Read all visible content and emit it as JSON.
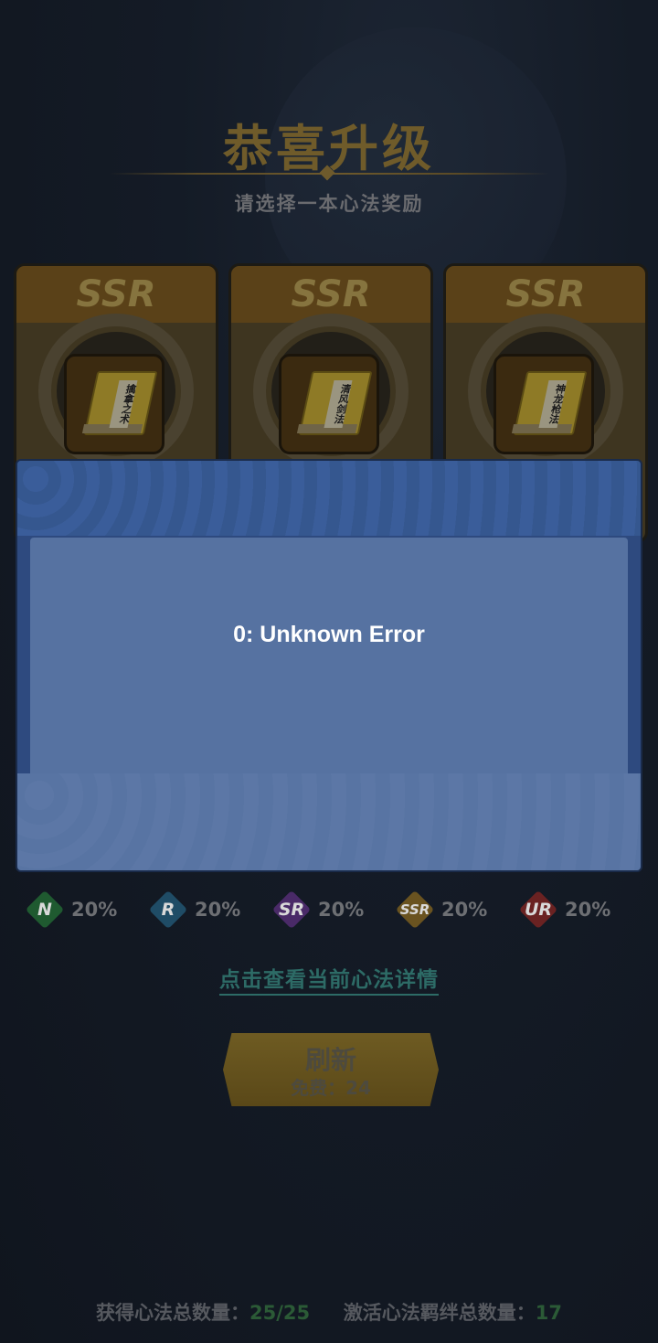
{
  "header": {
    "title": "恭喜升级",
    "subtitle": "请选择一本心法奖励"
  },
  "cards": [
    {
      "rarity": "SSR",
      "book_title": "擒拿之术"
    },
    {
      "rarity": "SSR",
      "book_title": "清风剑法"
    },
    {
      "rarity": "SSR",
      "book_title": "神龙枪法"
    }
  ],
  "dialog": {
    "message": "0: Unknown Error"
  },
  "rates": [
    {
      "tier": "N",
      "value": "20%",
      "color": "#1f5a30"
    },
    {
      "tier": "R",
      "value": "20%",
      "color": "#1f4c66"
    },
    {
      "tier": "SR",
      "value": "20%",
      "color": "#4a2a68"
    },
    {
      "tier": "SSR",
      "value": "20%",
      "color": "#6a5320"
    },
    {
      "tier": "UR",
      "value": "20%",
      "color": "#6a2222"
    }
  ],
  "detail_link": "点击查看当前心法详情",
  "refresh": {
    "label": "刷新",
    "cost_label": "免费：24"
  },
  "stats": {
    "obtained_label": "获得心法总数量：",
    "obtained_value": "25/25",
    "bond_label": "激活心法羁绊总数量：",
    "bond_value": "17"
  }
}
